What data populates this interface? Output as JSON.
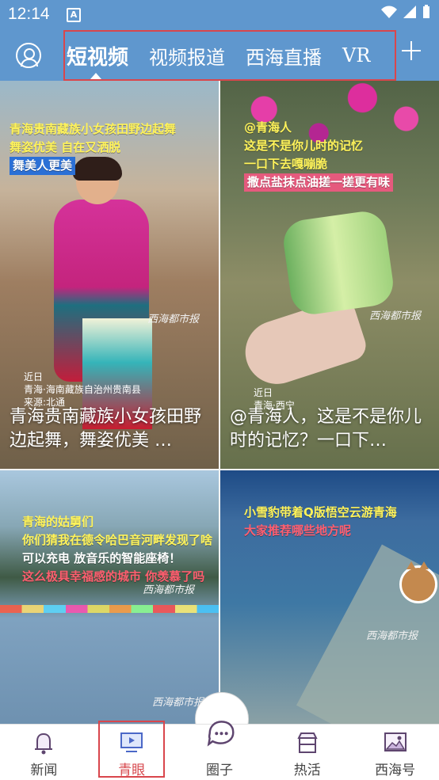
{
  "status": {
    "time": "12:14",
    "notification": "A"
  },
  "topbar": {
    "tabs": [
      {
        "label": "短视频"
      },
      {
        "label": "视频报道"
      },
      {
        "label": "西海直播"
      },
      {
        "label": "VR"
      }
    ]
  },
  "feed": {
    "cards": [
      {
        "caption_lines": [
          "青海贵南藏族小女孩田野边起舞",
          "舞姿优美 自在又洒脱",
          "舞美人更美"
        ],
        "meta_lines": [
          "近日",
          "青海·海南藏族自治州贵南县",
          "来源:北通"
        ],
        "title": "青海贵南藏族小女孩田野边起舞，舞姿优美 …",
        "watermark": "西海都市报"
      },
      {
        "caption_lines": [
          "@青海人",
          "这是不是你儿时的记忆",
          "一口下去嘎嘣脆",
          "撒点盐抹点油搓一搓更有味"
        ],
        "meta_lines": [
          "近日",
          "青海·西宁"
        ],
        "title": "@青海人，这是不是你儿时的记忆？一口下…",
        "watermark": "西海都市报"
      },
      {
        "caption_lines": [
          "青海的姑舅们",
          "你们猜我在德令哈巴音河畔发现了啥",
          "可以充电 放音乐的智能座椅！",
          "这么极具幸福感的城市 你羡慕了吗"
        ],
        "watermark": "西海都市报"
      },
      {
        "caption_lines": [
          "小雪豹带着Q版悟空云游青海",
          "大家推荐哪些地方呢"
        ],
        "watermark": "西海都市报"
      }
    ]
  },
  "bottom_nav": [
    {
      "label": "新闻"
    },
    {
      "label": "青眼"
    },
    {
      "label": "圈子"
    },
    {
      "label": "热活"
    },
    {
      "label": "西海号"
    }
  ]
}
